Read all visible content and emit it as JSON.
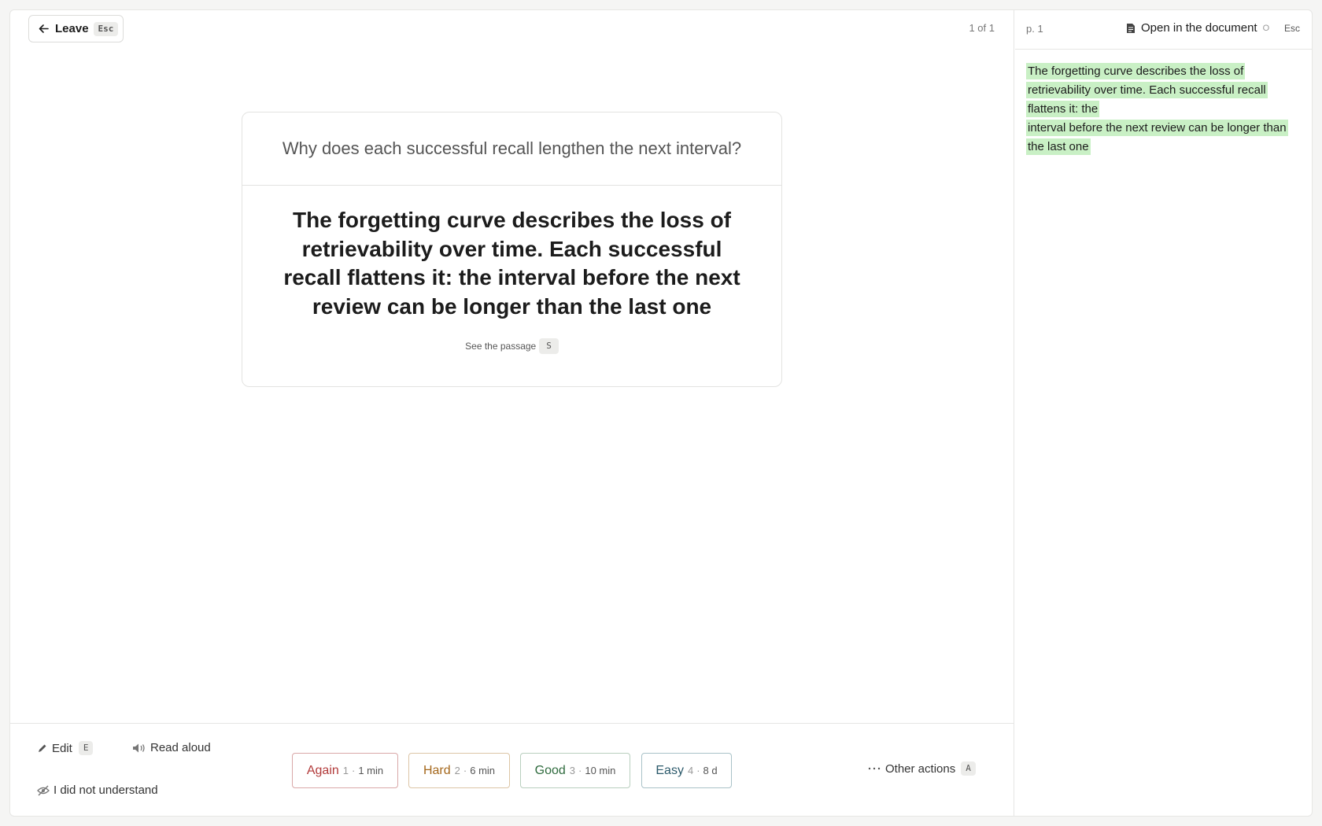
{
  "header": {
    "leave_label": "Leave",
    "leave_key": "Esc",
    "counter": "1 of 1"
  },
  "card": {
    "question": "Why does each successful recall lengthen the next interval?",
    "answer": "The forgetting curve describes the loss of retrievability over time. Each successful recall flattens it: the interval before the next review can be longer than the last one",
    "see_passage_label": "See the passage",
    "see_passage_key": "S"
  },
  "bottom": {
    "edit_label": "Edit",
    "edit_key": "E",
    "read_aloud_label": "Read aloud",
    "not_understand_label": "I did not understand",
    "other_actions_label": "Other actions",
    "other_actions_key": "A",
    "ratings": [
      {
        "label": "Again",
        "key": "1",
        "interval": "1 min",
        "color": "#b23a3a"
      },
      {
        "label": "Hard",
        "key": "2",
        "interval": "6 min",
        "color": "#a5681c"
      },
      {
        "label": "Good",
        "key": "3",
        "interval": "10 min",
        "color": "#2f6b3e"
      },
      {
        "label": "Easy",
        "key": "4",
        "interval": "8 d",
        "color": "#2c5a6b"
      }
    ]
  },
  "side": {
    "page": "p. 1",
    "open_doc_label": "Open in the document",
    "open_doc_key": "O",
    "close_key": "Esc",
    "passage_lines": [
      "The forgetting curve describes the loss of retrievability over time. Each successful recall flattens it: the",
      "interval before the next review can be longer than the last one"
    ],
    "highlight_color": "#c9f0c5"
  },
  "icons": [
    "arrow-left-icon",
    "pencil-icon",
    "speaker-icon",
    "eye-off-icon",
    "ellipsis-icon",
    "document-icon"
  ]
}
